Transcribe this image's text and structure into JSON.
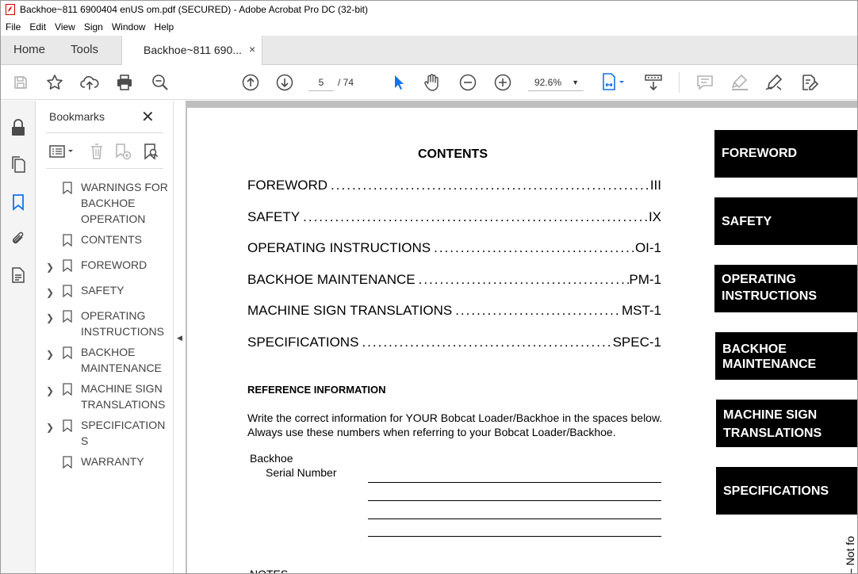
{
  "window": {
    "title": "Backhoe~811 6900404 enUS om.pdf (SECURED) - Adobe Acrobat Pro DC (32-bit)"
  },
  "menu": [
    "File",
    "Edit",
    "View",
    "Sign",
    "Window",
    "Help"
  ],
  "tabs": {
    "home": "Home",
    "tools": "Tools",
    "document": "Backhoe~811 690...",
    "close": "×"
  },
  "toolbar": {
    "current_page": "5",
    "total_pages": "/ 74",
    "zoom": "92.6%"
  },
  "bookmarks": {
    "title": "Bookmarks",
    "close": "✕",
    "items": [
      {
        "label": "WARNINGS FOR BACKHOE OPERATION",
        "expandable": false
      },
      {
        "label": "CONTENTS",
        "expandable": false
      },
      {
        "label": "FOREWORD",
        "expandable": true
      },
      {
        "label": "SAFETY",
        "expandable": true
      },
      {
        "label": "OPERATING INSTRUCTIONS",
        "expandable": true
      },
      {
        "label": "BACKHOE MAINTENANCE",
        "expandable": true
      },
      {
        "label": "MACHINE SIGN TRANSLATIONS",
        "expandable": true
      },
      {
        "label": "SPECIFICATION S",
        "expandable": true
      },
      {
        "label": "WARRANTY",
        "expandable": false
      }
    ]
  },
  "document": {
    "contents_title": "CONTENTS",
    "toc": [
      {
        "name": "FOREWORD",
        "page": "III"
      },
      {
        "name": "SAFETY",
        "page": "IX"
      },
      {
        "name": "OPERATING INSTRUCTIONS",
        "page": "OI-1"
      },
      {
        "name": "BACKHOE MAINTENANCE",
        "page": "PM-1"
      },
      {
        "name": "MACHINE SIGN TRANSLATIONS",
        "page": "MST-1"
      },
      {
        "name": "SPECIFICATIONS",
        "page": "SPEC-1"
      }
    ],
    "reference_heading": "REFERENCE INFORMATION",
    "reference_text_1": "Write the correct information for YOUR Bobcat Loader/Backhoe in the spaces below.",
    "reference_text_2": "Always use these numbers when referring to your Bobcat Loader/Backhoe.",
    "backhoe_label": "Backhoe",
    "serial_label": "Serial Number",
    "notes_label": "NOTES",
    "side_tabs": [
      {
        "line1": "FOREWORD",
        "line2": ""
      },
      {
        "line1": "SAFETY",
        "line2": ""
      },
      {
        "line1": "OPERATING",
        "line2": "INSTRUCTIONS"
      },
      {
        "line1": "BACKHOE",
        "line2": "MAINTENANCE"
      },
      {
        "line1": "MACHINE SIGN",
        "line2": "TRANSLATIONS"
      },
      {
        "line1": "SPECIFICATIONS",
        "line2": ""
      }
    ],
    "vertical_text": "y – Not fo"
  },
  "colors": {
    "accent_blue": "#1473e6",
    "icon_gray": "#4b4b4b",
    "disabled_gray": "#b3b3b3"
  }
}
